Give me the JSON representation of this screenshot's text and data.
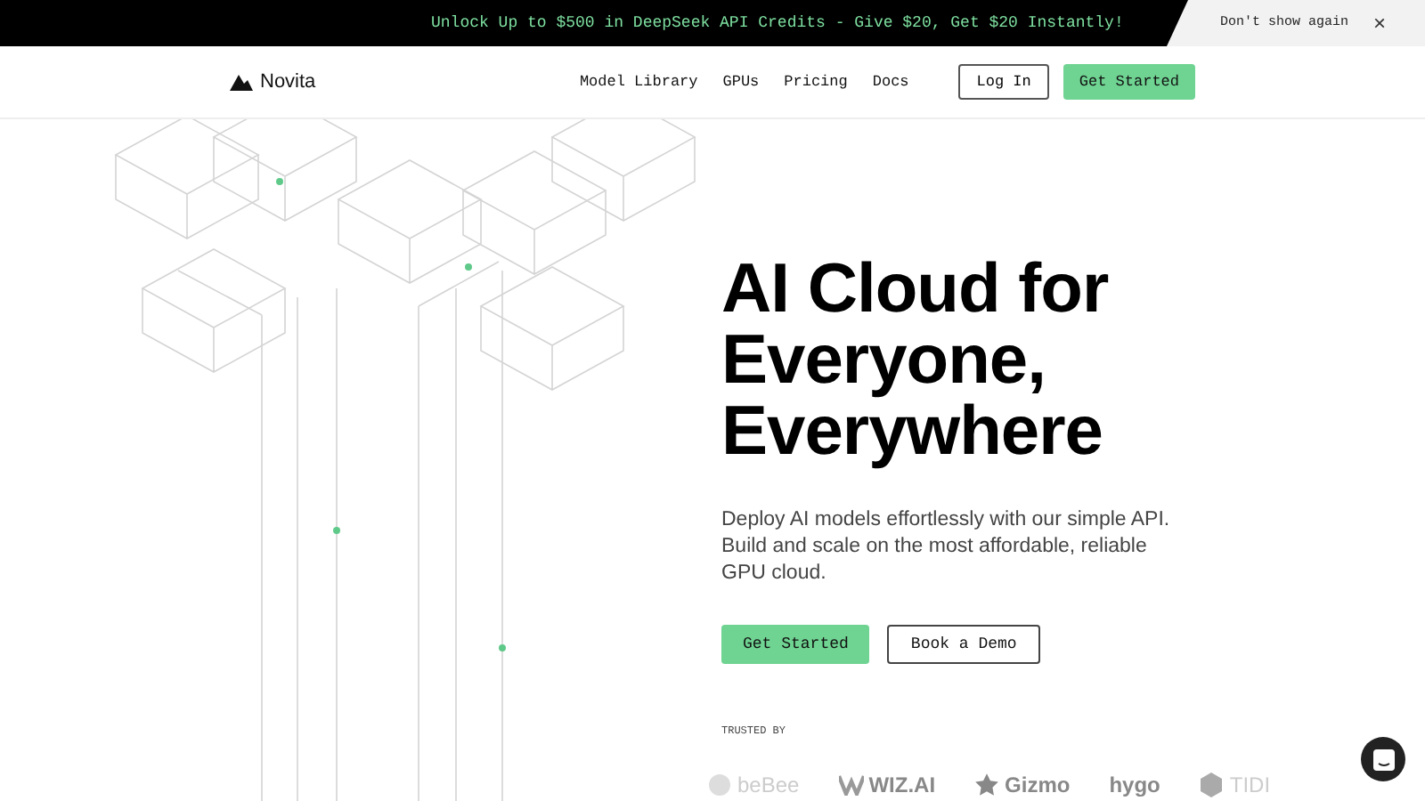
{
  "banner": {
    "message": "Unlock Up to $500 in DeepSeek API Credits - Give $20, Get $20 Instantly!",
    "dismiss": "Don't show again",
    "close": "×"
  },
  "nav": {
    "brand": "Novita",
    "links": [
      "Model Library",
      "GPUs",
      "Pricing",
      "Docs"
    ],
    "login": "Log In",
    "cta": "Get Started"
  },
  "hero": {
    "title": [
      "AI Cloud for",
      "Everyone,",
      "Everywhere"
    ],
    "subtitle": "Deploy AI models effortlessly with our simple API. Build and scale on the most affordable, reliable GPU cloud.",
    "primary": "Get Started",
    "secondary": "Book a Demo"
  },
  "trusted": {
    "label": "TRUSTED BY",
    "logos": [
      "beBee",
      "WIZ.AI",
      "Gizmo",
      "hygo",
      "TIDI"
    ]
  }
}
